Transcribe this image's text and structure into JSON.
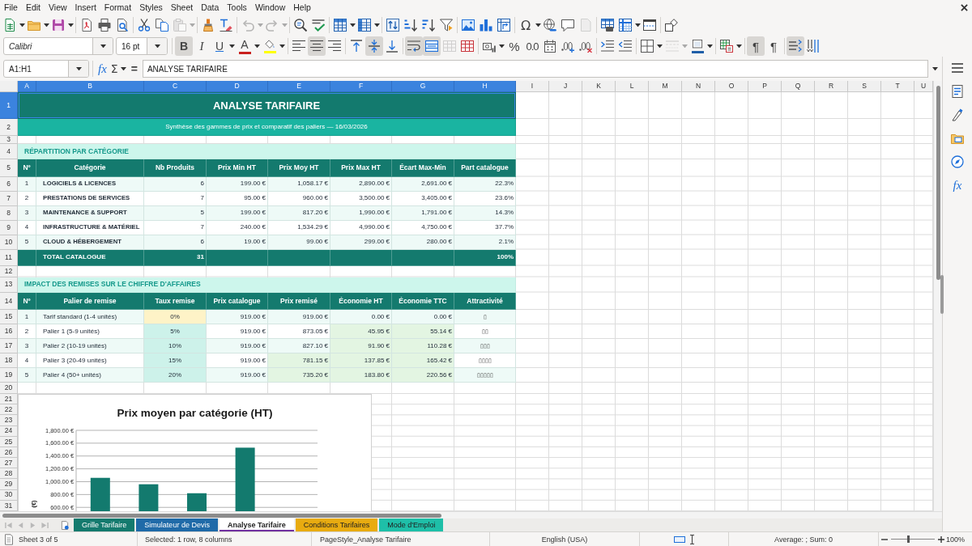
{
  "menu": [
    "File",
    "Edit",
    "View",
    "Insert",
    "Format",
    "Styles",
    "Sheet",
    "Data",
    "Tools",
    "Window",
    "Help"
  ],
  "standard_toolbar": [
    {
      "kind": "new",
      "disabled": false
    },
    {
      "kind": "open",
      "disabled": false
    },
    {
      "kind": "save",
      "disabled": false
    },
    {
      "kind": "export_pdf",
      "disabled": false
    },
    {
      "kind": "print",
      "disabled": false
    },
    {
      "kind": "print_preview",
      "disabled": false
    },
    {
      "kind": "cut",
      "disabled": false
    },
    {
      "kind": "copy",
      "disabled": false
    },
    {
      "kind": "paste",
      "disabled": true
    },
    {
      "kind": "clone_formatting",
      "disabled": false
    },
    {
      "kind": "clear_formatting",
      "disabled": false
    },
    {
      "kind": "undo",
      "disabled": true
    },
    {
      "kind": "redo",
      "disabled": true
    },
    {
      "kind": "find_replace",
      "disabled": false
    },
    {
      "kind": "spelling",
      "disabled": false
    },
    {
      "kind": "rows",
      "disabled": false
    },
    {
      "kind": "columns",
      "disabled": false
    },
    {
      "kind": "sort",
      "disabled": false
    },
    {
      "kind": "sort_ascending",
      "disabled": false
    },
    {
      "kind": "sort_descending",
      "disabled": false
    },
    {
      "kind": "autofilter",
      "disabled": false
    },
    {
      "kind": "image",
      "disabled": false
    },
    {
      "kind": "chart",
      "disabled": false
    },
    {
      "kind": "pivot_table",
      "disabled": false
    },
    {
      "kind": "special_character",
      "label": "Ω",
      "disabled": false
    },
    {
      "kind": "hyperlink",
      "disabled": false
    },
    {
      "kind": "comment",
      "disabled": false
    },
    {
      "kind": "headers_footers",
      "disabled": true
    },
    {
      "kind": "print_range",
      "disabled": false
    },
    {
      "kind": "freeze",
      "disabled": false
    },
    {
      "kind": "split_window",
      "disabled": false
    },
    {
      "kind": "shapes",
      "disabled": false
    }
  ],
  "formatting_toolbar": {
    "font_name": "Calibri",
    "font_size": "16 pt",
    "buttons": [
      {
        "kind": "bold",
        "label": "B",
        "pressed": true,
        "disabled": false
      },
      {
        "kind": "italic",
        "label": "I",
        "pressed": false,
        "disabled": false
      },
      {
        "kind": "underline",
        "label": "U",
        "pressed": false,
        "disabled": false
      },
      {
        "kind": "font_color",
        "label": "A",
        "color": "#c9211e",
        "pressed": false,
        "disabled": false
      },
      {
        "kind": "highlight",
        "color": "#ffff00",
        "pressed": false,
        "disabled": false
      },
      {
        "kind": "align_left",
        "pressed": false,
        "disabled": false
      },
      {
        "kind": "align_center",
        "pressed": true,
        "disabled": false
      },
      {
        "kind": "align_right",
        "pressed": false,
        "disabled": false
      },
      {
        "kind": "align_top",
        "pressed": false,
        "disabled": false
      },
      {
        "kind": "align_middle",
        "pressed": true,
        "disabled": false
      },
      {
        "kind": "align_bottom",
        "pressed": false,
        "disabled": false
      },
      {
        "kind": "wrap_text",
        "pressed": true,
        "disabled": false
      },
      {
        "kind": "merge_center",
        "pressed": true,
        "disabled": false
      },
      {
        "kind": "merge",
        "pressed": false,
        "disabled": true
      },
      {
        "kind": "unmerge",
        "pressed": false,
        "disabled": false
      },
      {
        "kind": "number_format",
        "pressed": false,
        "disabled": false
      },
      {
        "kind": "percent",
        "label": "%",
        "pressed": false,
        "disabled": false
      },
      {
        "kind": "standard",
        "label": "0.0",
        "pressed": false,
        "disabled": false
      },
      {
        "kind": "date",
        "pressed": false,
        "disabled": false
      },
      {
        "kind": "add_decimal",
        "pressed": false,
        "disabled": false
      },
      {
        "kind": "delete_decimal",
        "pressed": false,
        "disabled": false
      },
      {
        "kind": "increase_indent",
        "pressed": false,
        "disabled": false
      },
      {
        "kind": "decrease_indent",
        "pressed": false,
        "disabled": false
      },
      {
        "kind": "borders",
        "pressed": false,
        "disabled": false
      },
      {
        "kind": "border_style",
        "pressed": false,
        "disabled": true
      },
      {
        "kind": "border_color",
        "color": "#1f5fa8",
        "pressed": false,
        "disabled": false
      },
      {
        "kind": "conditional",
        "pressed": false,
        "disabled": false
      },
      {
        "kind": "ltr",
        "label": "¶",
        "pressed": true,
        "disabled": false
      },
      {
        "kind": "rtl",
        "label": "¶",
        "pressed": false,
        "disabled": false
      },
      {
        "kind": "text_direction",
        "pressed": true,
        "disabled": false
      },
      {
        "kind": "vertical_text",
        "pressed": false,
        "disabled": false
      }
    ]
  },
  "formula_bar": {
    "name_box": "A1:H1",
    "function_label": "fx",
    "sum_label": "Σ",
    "equals_label": "=",
    "formula": "ANALYSE TARIFAIRE"
  },
  "sheet": {
    "columns": [
      {
        "label": "A",
        "selected": true
      },
      {
        "label": "B",
        "selected": true
      },
      {
        "label": "C",
        "selected": true
      },
      {
        "label": "D",
        "selected": true
      },
      {
        "label": "E",
        "selected": true
      },
      {
        "label": "F",
        "selected": true
      },
      {
        "label": "G",
        "selected": true
      },
      {
        "label": "H",
        "selected": true
      },
      {
        "label": "I",
        "selected": false
      },
      {
        "label": "J",
        "selected": false
      },
      {
        "label": "K",
        "selected": false
      },
      {
        "label": "L",
        "selected": false
      },
      {
        "label": "M",
        "selected": false
      },
      {
        "label": "N",
        "selected": false
      },
      {
        "label": "O",
        "selected": false
      },
      {
        "label": "P",
        "selected": false
      },
      {
        "label": "Q",
        "selected": false
      },
      {
        "label": "R",
        "selected": false
      },
      {
        "label": "S",
        "selected": false
      },
      {
        "label": "T",
        "selected": false
      },
      {
        "label": "U",
        "selected": false
      }
    ],
    "rows": [
      {
        "label": "1",
        "selected": true
      },
      {
        "label": "2",
        "selected": false
      },
      {
        "label": "3",
        "selected": false
      },
      {
        "label": "4",
        "selected": false
      },
      {
        "label": "5",
        "selected": false
      },
      {
        "label": "6",
        "selected": false
      },
      {
        "label": "7",
        "selected": false
      },
      {
        "label": "8",
        "selected": false
      },
      {
        "label": "9",
        "selected": false
      },
      {
        "label": "10",
        "selected": false
      },
      {
        "label": "11",
        "selected": false
      },
      {
        "label": "12",
        "selected": false
      },
      {
        "label": "13",
        "selected": false
      },
      {
        "label": "14",
        "selected": false
      },
      {
        "label": "15",
        "selected": false
      },
      {
        "label": "16",
        "selected": false
      },
      {
        "label": "17",
        "selected": false
      },
      {
        "label": "18",
        "selected": false
      },
      {
        "label": "19",
        "selected": false
      },
      {
        "label": "20",
        "selected": false
      },
      {
        "label": "21",
        "selected": false
      },
      {
        "label": "22",
        "selected": false
      },
      {
        "label": "23",
        "selected": false
      },
      {
        "label": "24",
        "selected": false
      },
      {
        "label": "25",
        "selected": false
      },
      {
        "label": "26",
        "selected": false
      },
      {
        "label": "27",
        "selected": false
      },
      {
        "label": "28",
        "selected": false
      },
      {
        "label": "29",
        "selected": false
      },
      {
        "label": "30",
        "selected": false
      },
      {
        "label": "31",
        "selected": false
      }
    ],
    "title": "ANALYSE TARIFAIRE",
    "subtitle": "Synthèse des gammes de prix et comparatif des paliers — 16/03/2026",
    "sections": [
      {
        "kind": "category_summary",
        "heading": "RÉPARTITION PAR CATÉGORIE",
        "columns": [
          "Nº",
          "Catégorie",
          "Nb Produits",
          "Prix Min HT",
          "Prix Moy HT",
          "Prix Max HT",
          "Écart Max-Min",
          "Part catalogue"
        ],
        "rows": [
          [
            "1",
            "LOGICIELS & LICENCES",
            "6",
            "199.00 €",
            "1,058.17 €",
            "2,890.00 €",
            "2,691.00 €",
            "22.3%"
          ],
          [
            "2",
            "PRESTATIONS DE SERVICES",
            "7",
            "95.00 €",
            "960.00 €",
            "3,500.00 €",
            "3,405.00 €",
            "23.6%"
          ],
          [
            "3",
            "MAINTENANCE & SUPPORT",
            "5",
            "199.00 €",
            "817.20 €",
            "1,990.00 €",
            "1,791.00 €",
            "14.3%"
          ],
          [
            "4",
            "INFRASTRUCTURE & MATÉRIEL",
            "7",
            "240.00 €",
            "1,534.29 €",
            "4,990.00 €",
            "4,750.00 €",
            "37.7%"
          ],
          [
            "5",
            "CLOUD & HÉBERGEMENT",
            "6",
            "19.00 €",
            "99.00 €",
            "299.00 €",
            "280.00 €",
            "2.1%"
          ]
        ],
        "total": {
          "label": "TOTAL CATALOGUE",
          "count": "31",
          "share": "100%"
        }
      },
      {
        "kind": "discount_tiers",
        "heading": "IMPACT DES REMISES SUR LE CHIFFRE D'AFFAIRES",
        "columns": [
          "Nº",
          "Palier de remise",
          "Taux remise",
          "Prix catalogue",
          "Prix remisé",
          "Économie HT",
          "Économie TTC",
          "Attractivité"
        ],
        "rows": [
          [
            "1",
            "Tarif standard (1-4 unités)",
            {
              "text": "0%",
              "color": "#fef3c7"
            },
            "919.00 €",
            "919.00 €",
            "0.00 €",
            "0.00 €",
            "▯"
          ],
          [
            "2",
            "Palier 1 (5-9 unités)",
            {
              "text": "5%",
              "color": "#cdf2ea"
            },
            "919.00 €",
            "873.05 €",
            {
              "text": "45.95 €",
              "color": "#e3f5e2"
            },
            {
              "text": "55.14 €",
              "color": "#e3f5e2"
            },
            "▯▯"
          ],
          [
            "3",
            "Palier 2 (10-19 unités)",
            {
              "text": "10%",
              "color": "#cdf2ea"
            },
            "919.00 €",
            "827.10 €",
            {
              "text": "91.90 €",
              "color": "#e3f5e2"
            },
            {
              "text": "110.28 €",
              "color": "#e3f5e2"
            },
            "▯▯▯"
          ],
          [
            "4",
            "Palier 3 (20-49 unités)",
            {
              "text": "15%",
              "color": "#cdf2ea"
            },
            "919.00 €",
            {
              "text": "781.15 €",
              "color": "#e3f5e2"
            },
            {
              "text": "137.85 €",
              "color": "#e3f5e2"
            },
            {
              "text": "165.42 €",
              "color": "#e3f5e2"
            },
            "▯▯▯▯"
          ],
          [
            "5",
            "Palier 4 (50+ unités)",
            {
              "text": "20%",
              "color": "#cdf2ea"
            },
            "919.00 €",
            {
              "text": "735.20 €",
              "color": "#e3f5e2"
            },
            {
              "text": "183.80 €",
              "color": "#e3f5e2"
            },
            {
              "text": "220.56 €",
              "color": "#e3f5e2"
            },
            "▯▯▯▯▯"
          ]
        ]
      }
    ],
    "chart": {
      "chart_data": {
        "type": "bar",
        "title": "Prix moyen par catégorie (HT)",
        "ylabel": "(€)",
        "grid": true,
        "series": [
          {
            "color": "#137a6e",
            "values": [
              1060,
              960,
              820,
              1530
            ]
          }
        ],
        "ylim": [
          540,
          1800
        ],
        "yticks": [
          {
            "value": 600,
            "label": "600.00 €"
          },
          {
            "value": 800,
            "label": "800.00 €"
          },
          {
            "value": 1000,
            "label": "1,000.00 €"
          },
          {
            "value": 1200,
            "label": "1,200.00 €"
          },
          {
            "value": 1400,
            "label": "1,400.00 €"
          },
          {
            "value": 1600,
            "label": "1,600.00 €"
          },
          {
            "value": 1800,
            "label": "1,800.00 €"
          }
        ]
      }
    }
  },
  "sheet_tabs": {
    "navigation_disabled": true,
    "tabs": [
      {
        "label": "Grille Tarifaire",
        "color": "#147a6e",
        "selected": false
      },
      {
        "label": "Simulateur de Devis",
        "color": "#1f6aa8",
        "selected": false
      },
      {
        "label": "Analyse Tarifaire",
        "color": "#7030a0",
        "selected": true
      },
      {
        "label": "Conditions Tarifaires",
        "color": "#e8ab10",
        "selected": false
      },
      {
        "label": "Mode d'Emploi",
        "color": "#1ebfa8",
        "selected": false
      }
    ]
  },
  "sidebar": {
    "functions_label": "fx"
  },
  "status_bar": {
    "sheet": "Sheet 3 of 5",
    "selection": "Selected: 1 row, 8 columns",
    "page_style": "PageStyle_Analyse Tarifaire",
    "language": "English (USA)",
    "summary": "Average: ; Sum: 0",
    "zoom": {
      "level": 0.4,
      "reading": "100%"
    }
  }
}
